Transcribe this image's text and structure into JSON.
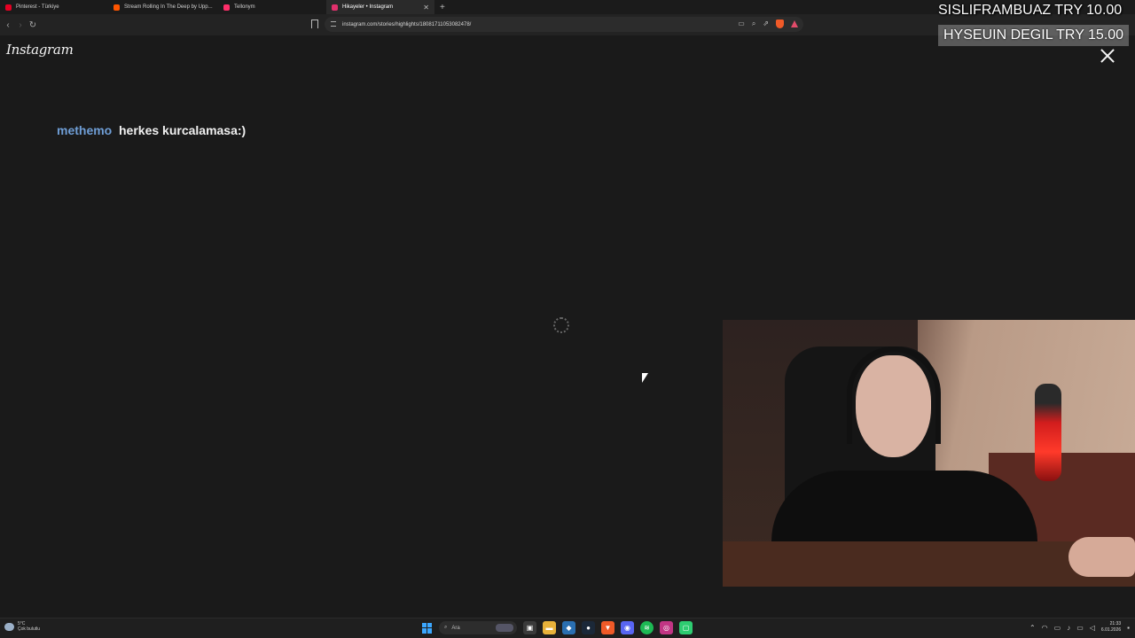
{
  "browser": {
    "tabs": [
      {
        "title": "Pinterest - Türkiye",
        "color": "#e60023",
        "active": false
      },
      {
        "title": "Stream Rolling In The Deep by Upp...",
        "color": "#ff5500",
        "active": false
      },
      {
        "title": "Tellonym",
        "color": "#ff2e6a",
        "active": false
      },
      {
        "title": "Hikayeler • Instagram",
        "color": "#e1306c",
        "active": true
      }
    ],
    "url": "instagram.com/stories/highlights/18081711053082478/"
  },
  "page": {
    "logo": "Instagram",
    "story_username": "methemo",
    "story_title": "herkes kurcalamasa:)"
  },
  "overlay": {
    "donation_top": "SISLIFRAMBUAZ TRY 10.00",
    "donation_badge": "HYSEUIN DEGIL  TRY 15.00"
  },
  "taskbar": {
    "weather_temp": "5°C",
    "weather_desc": "Çok bulutlu",
    "search_placeholder": "Ara",
    "time": "21:33",
    "date": "6.01.2026"
  },
  "colors": {
    "username": "#6f9ed6",
    "background": "#1a1a1a",
    "windows_accent": "#3ba7ff"
  }
}
